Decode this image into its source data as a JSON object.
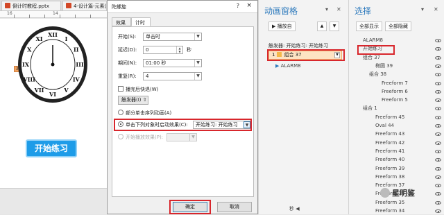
{
  "tabs": [
    {
      "label": "倒计时教程.pptx"
    },
    {
      "label": "4-设计篇-元素逆"
    }
  ],
  "ruler": {
    "labels": [
      "16",
      "14"
    ]
  },
  "slide": {
    "anim_badge": "3",
    "start_button": "开始练习",
    "clock_numerals": [
      "XII",
      "I",
      "II",
      "III",
      "IV",
      "V",
      "VI",
      "VII",
      "VIII",
      "IX",
      "X",
      "XI"
    ]
  },
  "dialog": {
    "title": "陀螺旋",
    "help": "?",
    "close": "×",
    "tabs": [
      "效果",
      "计时"
    ],
    "start_label": "开始(S):",
    "start_value": "单击时",
    "delay_label": "延迟(D):",
    "delay_value": "0",
    "delay_unit": "秒",
    "duration_label": "期间(N):",
    "duration_value": "01:00 秒",
    "repeat_label": "重复(R):",
    "repeat_value": "4",
    "rewind_label": "播完后快退(W)",
    "trigger_button": "触发器(I) ⇧",
    "radio_sequence": "部分单击序列动画(A)",
    "radio_click": "单击下列对象时启动效果(C):",
    "click_target": "开始练习: 开始练习",
    "radio_play": "开始播放效果(P):",
    "ok": "确定",
    "cancel": "取消"
  },
  "anim_pane": {
    "title": "动画窗格",
    "play_from": "播放自",
    "trigger_label": "触发器: 开始练习: 开始练习",
    "item_num": "1",
    "item_label": "组合 37",
    "sub_item": "ALARM8",
    "footer_label": "秒",
    "footer_arrow": "◀"
  },
  "selection_pane": {
    "title": "选择",
    "show_all": "全部显示",
    "hide_all": "全部隐藏",
    "items": [
      {
        "label": "ALARM8",
        "indent": 0
      },
      {
        "label": "开始练习",
        "indent": 0
      },
      {
        "label": "组合 37",
        "indent": 0
      },
      {
        "label": "椭圆 39",
        "indent": 2
      },
      {
        "label": "组合 38",
        "indent": 1
      },
      {
        "label": "Freeform 7",
        "indent": 3
      },
      {
        "label": "Freeform 6",
        "indent": 3
      },
      {
        "label": "Freeform 5",
        "indent": 3
      },
      {
        "label": "组合 1",
        "indent": 0
      },
      {
        "label": "Freeform 45",
        "indent": 2
      },
      {
        "label": "Oval 44",
        "indent": 2
      },
      {
        "label": "Freeform 43",
        "indent": 2
      },
      {
        "label": "Freeform 42",
        "indent": 2
      },
      {
        "label": "Freeform 41",
        "indent": 2
      },
      {
        "label": "Freeform 40",
        "indent": 2
      },
      {
        "label": "Freeform 39",
        "indent": 2
      },
      {
        "label": "Freeform 38",
        "indent": 2
      },
      {
        "label": "Freeform 37",
        "indent": 2
      },
      {
        "label": "Freeform 36",
        "indent": 2
      },
      {
        "label": "Freeform 35",
        "indent": 2
      },
      {
        "label": "Freeform 34",
        "indent": 2
      }
    ]
  },
  "watermark": "星明鉴"
}
